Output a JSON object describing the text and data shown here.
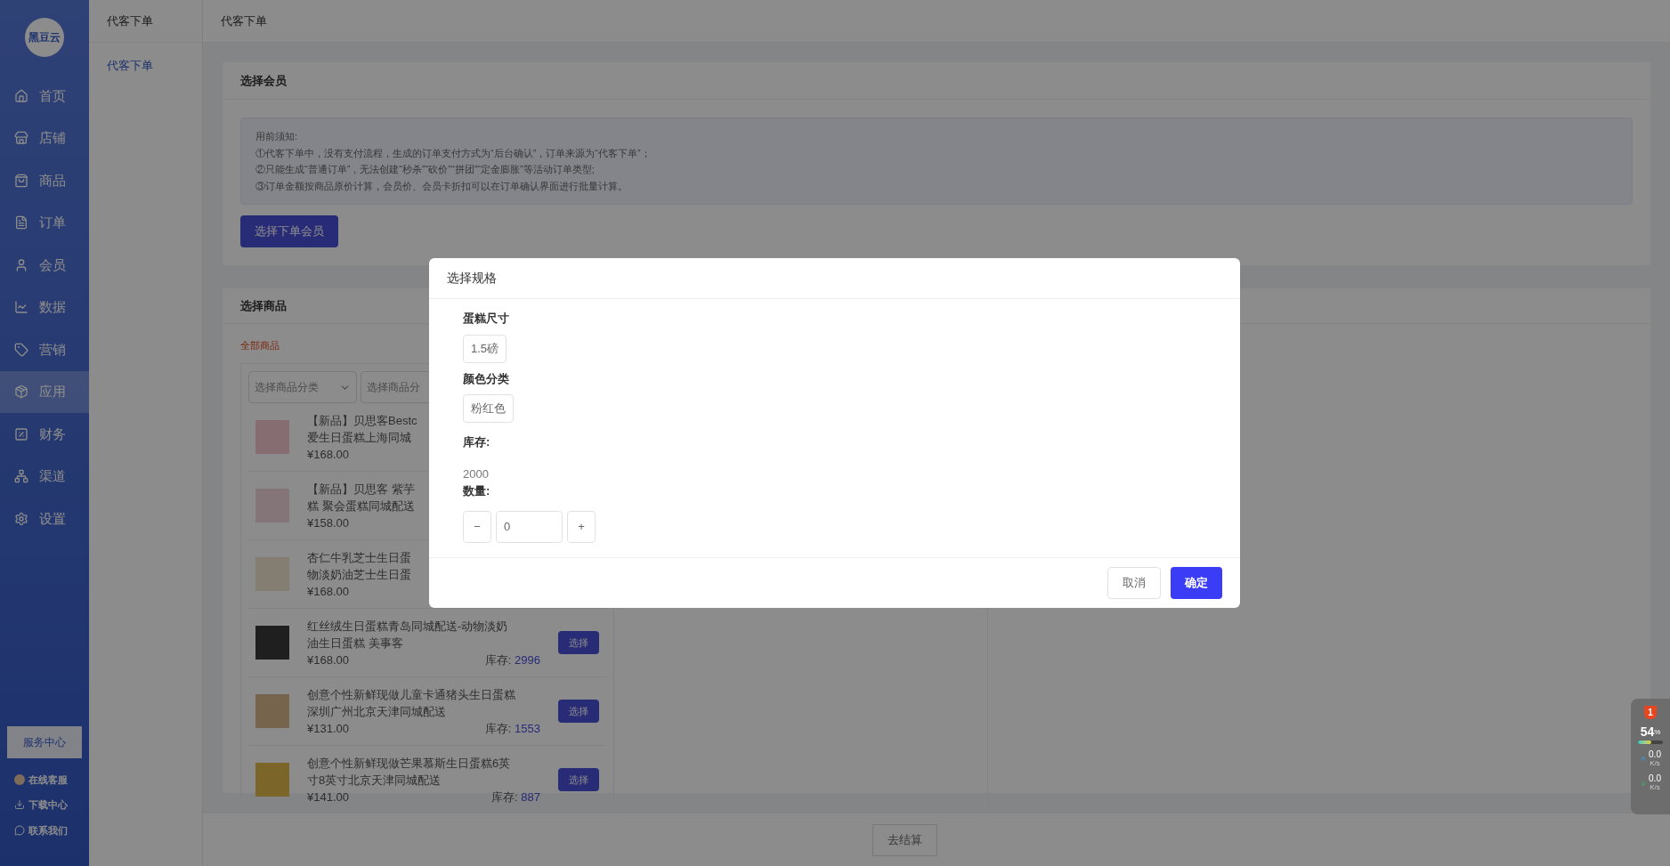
{
  "sidebar": {
    "logo": "黑豆云",
    "items": [
      {
        "label": "首页",
        "selected": false
      },
      {
        "label": "店铺",
        "selected": false
      },
      {
        "label": "商品",
        "selected": false
      },
      {
        "label": "订单",
        "selected": false
      },
      {
        "label": "会员",
        "selected": false
      },
      {
        "label": "数据",
        "selected": false
      },
      {
        "label": "营销",
        "selected": false
      },
      {
        "label": "应用",
        "selected": true
      },
      {
        "label": "财务",
        "selected": false
      },
      {
        "label": "渠道",
        "selected": false
      },
      {
        "label": "设置",
        "selected": false
      }
    ],
    "service_button": "服务中心",
    "links": [
      "在线客服",
      "下载中心",
      "联系我们"
    ]
  },
  "subnav": {
    "title": "代客下单",
    "items": [
      {
        "label": "代客下单",
        "selected": true
      }
    ]
  },
  "breadcrumb": "代客下单",
  "member_section": {
    "title": "选择会员",
    "notice": [
      "用前须知:",
      "①代客下单中，没有支付流程，生成的订单支付方式为“后台确认”，订单来源为“代客下单”；",
      "②只能生成“普通订单”，无法创建“秒杀”“砍价”“拼团”“定金膨胀”等活动订单类型;",
      "③订单金额按商品原价计算，会员价、会员卡折扣可以在订单确认界面进行批量计算。"
    ],
    "button": "选择下单会员"
  },
  "product_section": {
    "title": "选择商品",
    "tab": "全部商品",
    "filters": [
      {
        "placeholder": "选择商品分类"
      },
      {
        "placeholder": "选择商品分"
      }
    ],
    "products": [
      {
        "title_lines": [
          "【新品】贝思客Bestc",
          "爱生日蛋糕上海同城"
        ],
        "price": "¥168.00"
      },
      {
        "title_lines": [
          "【新品】贝思客 紫芋",
          "糕 聚会蛋糕同城配送"
        ],
        "price": "¥158.00"
      },
      {
        "title_lines": [
          "杏仁牛乳芝士生日蛋",
          "物淡奶油芝士生日蛋"
        ],
        "price": "¥168.00"
      },
      {
        "title_lines": [
          "红丝绒生日蛋糕青岛同城配送-动物淡奶",
          "油生日蛋糕 美事客"
        ],
        "price": "¥168.00",
        "stock_label": "库存:",
        "stock": "2996",
        "button": "选择"
      },
      {
        "title_lines": [
          "创意个性新鲜现做儿童卡通猪头生日蛋糕",
          "深圳广州北京天津同城配送"
        ],
        "price": "¥131.00",
        "stock_label": "库存:",
        "stock": "1553",
        "button": "选择"
      },
      {
        "title_lines": [
          "创意个性新鲜现做芒果慕斯生日蛋糕6英",
          "寸8英寸北京天津同城配送"
        ],
        "price": "¥141.00",
        "stock_label": "库存:",
        "stock": "887",
        "button": "选择"
      }
    ]
  },
  "checkout_button": "去结算",
  "modal": {
    "title": "选择规格",
    "groups": [
      {
        "name": "蛋糕尺寸",
        "options": [
          "1.5磅"
        ]
      },
      {
        "name": "颜色分类",
        "options": [
          "粉红色"
        ]
      }
    ],
    "stock_label": "库存:",
    "stock": "2000",
    "quantity_label": "数量:",
    "quantity": "0",
    "minus": "−",
    "plus": "+",
    "cancel": "取消",
    "confirm": "确定"
  },
  "system_widget": {
    "badge": "1",
    "reading": "54",
    "unit": "%",
    "level": 0.54,
    "upload": "0.0",
    "upload_unit": "K/s",
    "download": "0.0",
    "download_unit": "K/s"
  }
}
